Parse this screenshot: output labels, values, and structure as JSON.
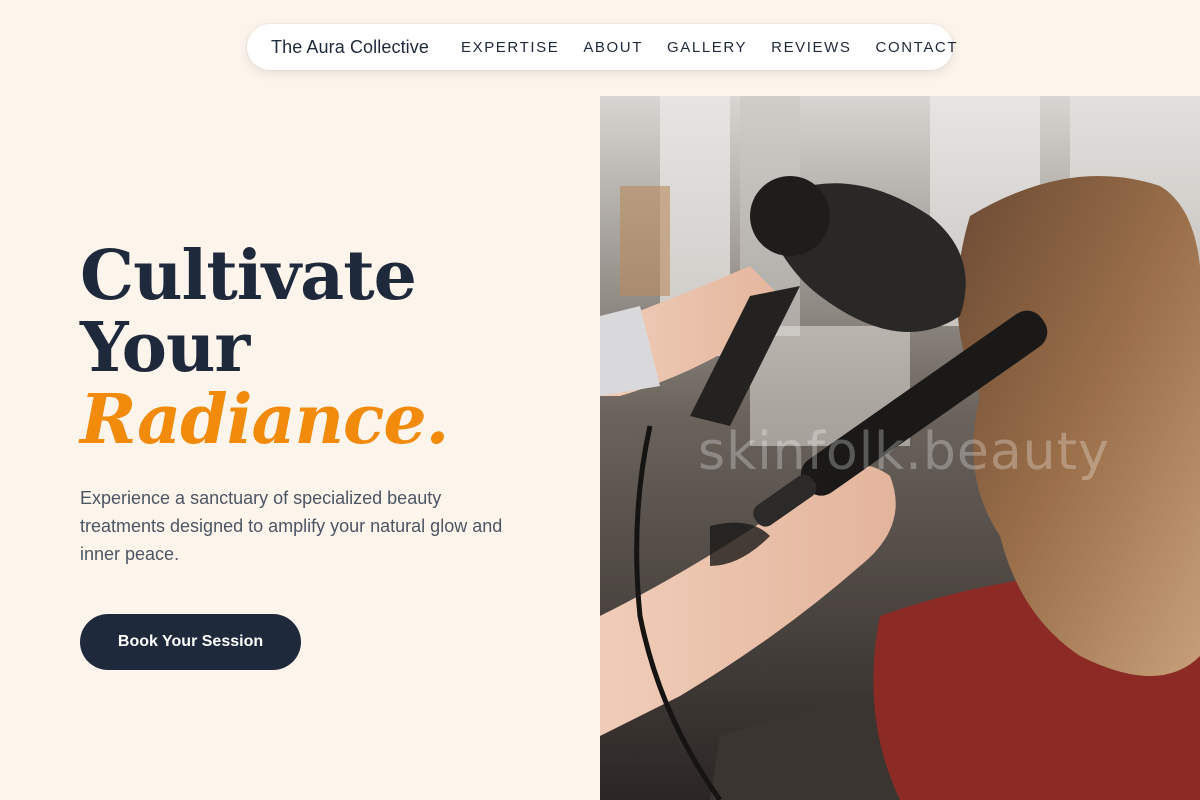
{
  "nav": {
    "brand": "The Aura Collective",
    "links": [
      {
        "label": "EXPERTISE"
      },
      {
        "label": "ABOUT"
      },
      {
        "label": "GALLERY"
      },
      {
        "label": "REVIEWS"
      },
      {
        "label": "CONTACT"
      }
    ]
  },
  "hero": {
    "headline_line1": "Cultivate",
    "headline_line2": "Your",
    "headline_accent": "Radiance.",
    "subtext": "Experience a sanctuary of specialized beauty treatments designed to amplify your natural glow and inner peace.",
    "cta_label": "Book Your Session"
  },
  "image": {
    "watermark": "skinfolk.beauty",
    "description_icon": "hair-salon-photo"
  },
  "colors": {
    "background": "#fdf5ec",
    "text_dark": "#1e293b",
    "accent": "#f28a0c",
    "subtext": "#4b5563",
    "button_bg": "#1e293b",
    "button_text": "#ffffff"
  }
}
